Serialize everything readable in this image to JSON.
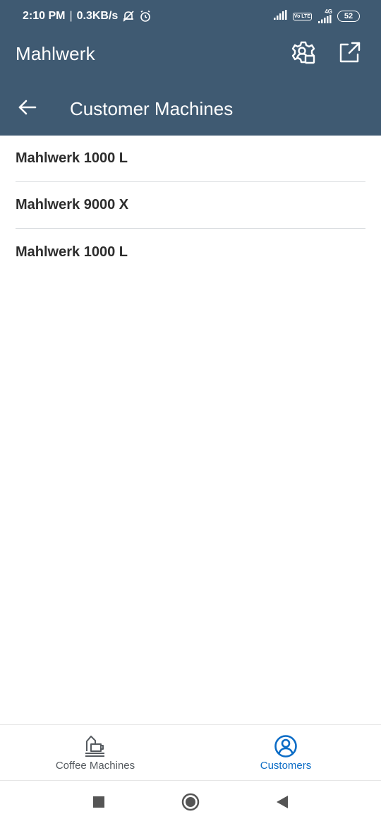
{
  "status_bar": {
    "time": "2:10 PM",
    "separator": "|",
    "network_speed": "0.3KB/s",
    "battery_level": "52",
    "volte_label": "Vo LTE",
    "network_type": "4G",
    "icons": [
      "alarm-off-icon",
      "alarm-clock-icon",
      "signal-icon",
      "volte-icon",
      "signal-4g-icon",
      "battery-icon"
    ]
  },
  "app_bar": {
    "title": "Mahlwerk",
    "actions": [
      "settings-icon",
      "share-icon"
    ]
  },
  "sub_header": {
    "title": "Customer Machines",
    "back_icon": "arrow-left-icon"
  },
  "machines": [
    {
      "name": "Mahlwerk 1000 L"
    },
    {
      "name": "Mahlwerk 9000 X"
    },
    {
      "name": "Mahlwerk 1000 L"
    }
  ],
  "bottom_nav": {
    "tabs": [
      {
        "label": "Coffee Machines",
        "icon": "coffee-machine-icon",
        "active": false
      },
      {
        "label": "Customers",
        "icon": "customer-icon",
        "active": true
      }
    ]
  },
  "colors": {
    "header_bg": "#3f5a72",
    "accent": "#0b6cc6",
    "divider": "#d9dcdf",
    "text": "#2d2d2d"
  }
}
